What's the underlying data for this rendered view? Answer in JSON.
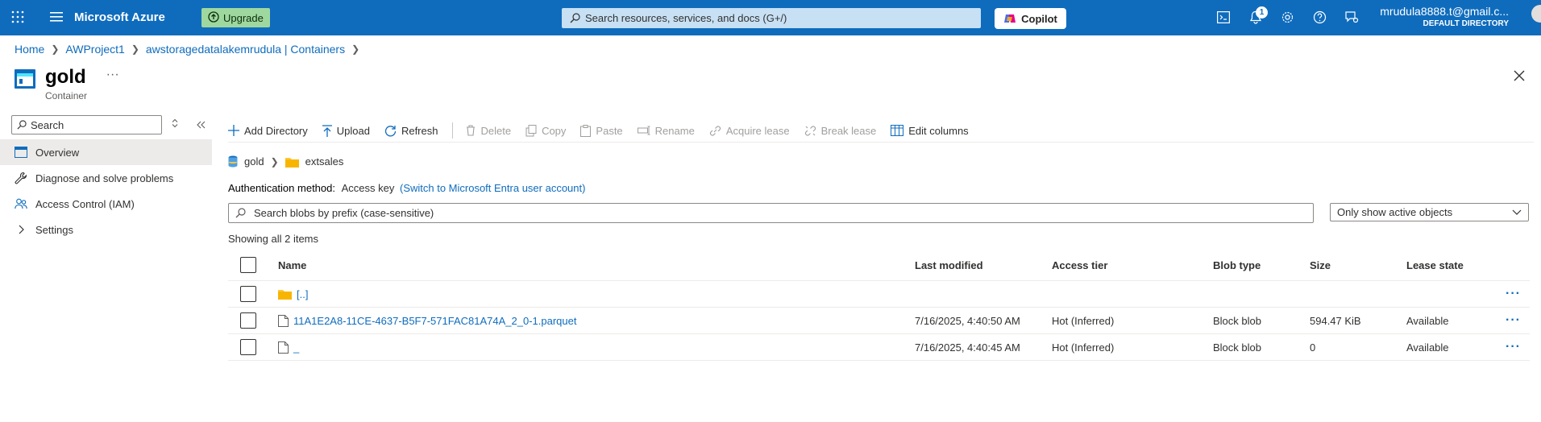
{
  "topbar": {
    "brand": "Microsoft Azure",
    "upgrade_label": "Upgrade",
    "search_placeholder": "Search resources, services, and docs (G+/)",
    "copilot_label": "Copilot",
    "notifications_count": "1",
    "account_email": "mrudula8888.t@gmail.c...",
    "account_directory": "DEFAULT DIRECTORY"
  },
  "breadcrumb": [
    {
      "label": "Home"
    },
    {
      "label": "AWProject1"
    },
    {
      "label": "awstoragedatalakemrudula | Containers"
    }
  ],
  "page": {
    "title": "gold",
    "subtitle": "Container",
    "more_label": "···"
  },
  "sidebar": {
    "search_placeholder": "Search",
    "items": [
      {
        "label": "Overview",
        "active": true
      },
      {
        "label": "Diagnose and solve problems"
      },
      {
        "label": "Access Control (IAM)"
      },
      {
        "label": "Settings"
      }
    ]
  },
  "toolbar": {
    "add_directory": "Add Directory",
    "upload": "Upload",
    "refresh": "Refresh",
    "delete": "Delete",
    "copy": "Copy",
    "paste": "Paste",
    "rename": "Rename",
    "acquire_lease": "Acquire lease",
    "break_lease": "Break lease",
    "edit_columns": "Edit columns"
  },
  "path": {
    "root": "gold",
    "folder": "extsales"
  },
  "auth": {
    "label": "Authentication method:",
    "value": "Access key",
    "switch_link": "(Switch to Microsoft Entra user account)"
  },
  "blob_search": {
    "placeholder": "Search blobs by prefix (case-sensitive)"
  },
  "filter": {
    "selected": "Only show active objects"
  },
  "showing_text": "Showing all 2 items",
  "table": {
    "columns": [
      "Name",
      "Last modified",
      "Access tier",
      "Blob type",
      "Size",
      "Lease state"
    ],
    "rows": [
      {
        "name": "[..]",
        "type": "folder",
        "modified": "",
        "tier": "",
        "blob_type": "",
        "size": "",
        "lease": ""
      },
      {
        "name": "11A1E2A8-11CE-4637-B5F7-571FAC81A74A_2_0-1.parquet",
        "type": "file",
        "modified": "7/16/2025, 4:40:50 AM",
        "tier": "Hot (Inferred)",
        "blob_type": "Block blob",
        "size": "594.47 KiB",
        "lease": "Available"
      },
      {
        "name": "_",
        "type": "file",
        "modified": "7/16/2025, 4:40:45 AM",
        "tier": "Hot (Inferred)",
        "blob_type": "Block blob",
        "size": "0",
        "lease": "Available"
      }
    ]
  },
  "colors": {
    "azure_blue": "#0f6cbd",
    "upgrade_green": "#9fd89f",
    "folder_yellow": "#ffc83d"
  }
}
